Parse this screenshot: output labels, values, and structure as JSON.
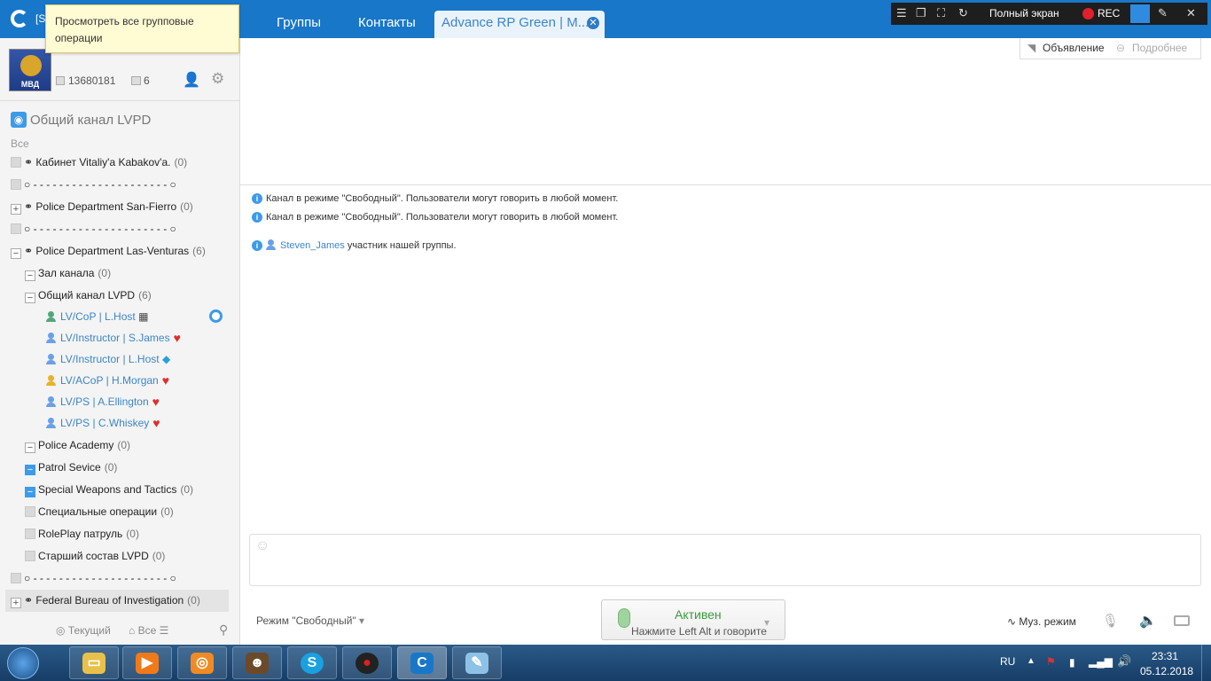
{
  "tooltip": {
    "text": "Просмотреть все групповые операции"
  },
  "header": {
    "tabs": [
      {
        "label": "Группы"
      },
      {
        "label": "Контакты"
      },
      {
        "label": "Advance RP Green | M..."
      }
    ],
    "app_title_fragment": "[S"
  },
  "recorder": {
    "fullscreen_label": "Полный экран",
    "rec_label": "REC"
  },
  "profile": {
    "avatar_text": "МВД",
    "id": "13680181",
    "members": "6"
  },
  "channel": {
    "title": "Общий канал LVPD",
    "filter_all": "Все"
  },
  "tree": [
    {
      "label": "Кабинет Vitaliy'a Kabakov'a.",
      "count": "(0)"
    },
    {
      "label": "- - - - - - - - - - - - - - - - - - - - -",
      "count": ""
    },
    {
      "label": "Police Department San-Fierro",
      "count": "(0)"
    },
    {
      "label": "- - - - - - - - - - - - - - - - - - - - -",
      "count": ""
    },
    {
      "label": "Police Department Las-Venturas",
      "count": "(6)"
    },
    {
      "label": "Зал канала",
      "count": "(0)"
    },
    {
      "label": "Общий канал LVPD",
      "count": "(6)"
    },
    {
      "label": "Police Academy",
      "count": "(0)"
    },
    {
      "label": "Patrol Sevice",
      "count": "(0)"
    },
    {
      "label": "Special Weapons and Tactics",
      "count": "(0)"
    },
    {
      "label": "Специальные операции",
      "count": "(0)"
    },
    {
      "label": "RolePlay патруль",
      "count": "(0)"
    },
    {
      "label": "Старший состав LVPD",
      "count": "(0)"
    },
    {
      "label": "- - - - - - - - - - - - - - - - - - - - -",
      "count": ""
    },
    {
      "label": "Federal Bureau of Investigation",
      "count": "(0)"
    }
  ],
  "users": [
    {
      "name": "LV/CoP | L.Host"
    },
    {
      "name": "LV/Instructor | S.James"
    },
    {
      "name": "LV/Instructor | L.Host"
    },
    {
      "name": "LV/ACoP | H.Morgan"
    },
    {
      "name": "LV/PS | A.Ellington"
    },
    {
      "name": "LV/PS | C.Whiskey"
    }
  ],
  "left_footer": {
    "current": "Текущий",
    "all": "Все"
  },
  "announce": {
    "announcement": "Объявление",
    "more": "Подробнее"
  },
  "messages": [
    {
      "text": "Канал в режиме \"Свободный\". Пользователи могут говорить в любой момент."
    },
    {
      "text": "Канал в режиме \"Свободный\". Пользователи могут говорить в любой момент."
    },
    {
      "user": "Steven_James",
      "text": "участник нашей группы."
    }
  ],
  "bottom": {
    "mode": "Режим \"Свободный\"",
    "active": "Активен",
    "hint": "Нажмите Left Alt и говорите",
    "music": "Муз. режим"
  },
  "taskbar": {
    "lang": "RU",
    "time": "23:31",
    "date": "05.12.2018"
  },
  "colors": {
    "accent": "#1877c9",
    "link": "#3c86c9",
    "active_green": "#3a9a3a"
  }
}
